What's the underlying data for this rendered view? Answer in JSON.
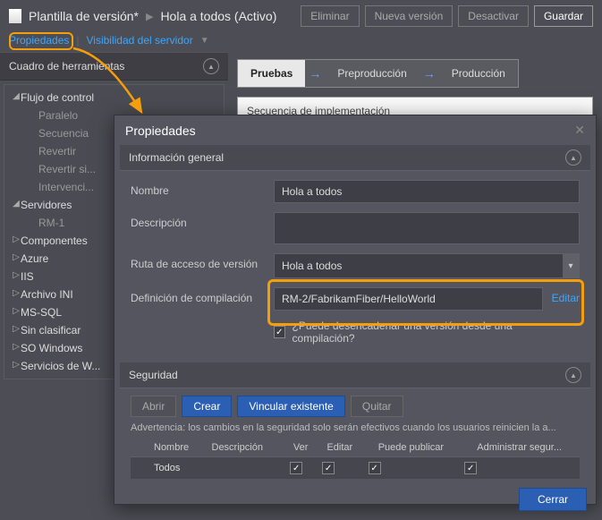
{
  "header": {
    "template_title": "Plantilla de versión*",
    "active_title": "Hola a todos (Activo)",
    "buttons": {
      "delete": "Eliminar",
      "new_version": "Nueva versión",
      "deactivate": "Desactivar",
      "save": "Guardar"
    }
  },
  "tabs": {
    "properties": "Propiedades",
    "server_visibility": "Visibilidad del servidor"
  },
  "toolbox": {
    "title": "Cuadro de herramientas",
    "flow_control": "Flujo de control",
    "flow_items": [
      "Paralelo",
      "Secuencia",
      "Revertir",
      "Revertir si...",
      "Intervenci..."
    ],
    "servers": "Servidores",
    "server_items": [
      "RM-1"
    ],
    "other_groups": [
      "Componentes",
      "Azure",
      "IIS",
      "Archivo INI",
      "MS-SQL",
      "Sin clasificar",
      "SO Windows",
      "Servicios de W..."
    ]
  },
  "stages": {
    "pruebas": "Pruebas",
    "preprod": "Preproducción",
    "prod": "Producción"
  },
  "sequence_label": "Secuencia de implementación",
  "panel": {
    "title": "Propiedades",
    "seccion_general": "Información general",
    "nombre_label": "Nombre",
    "nombre_value": "Hola a todos",
    "descripcion_label": "Descripción",
    "descripcion_value": "",
    "ruta_label": "Ruta de acceso de versión",
    "ruta_value": "Hola a todos",
    "def_label": "Definición de compilación",
    "def_value": "RM-2/FabrikamFiber/HelloWorld",
    "editar": "Editar",
    "trigger_label": "¿Puede desencadenar una versión desde una compilación?",
    "seguridad": "Seguridad",
    "btn_abrir": "Abrir",
    "btn_crear": "Crear",
    "btn_vincular": "Vincular existente",
    "btn_quitar": "Quitar",
    "warning": "Advertencia: los cambios en la seguridad solo serán efectivos cuando los usuarios reinicien la a...",
    "cols": {
      "nombre": "Nombre",
      "descripcion": "Descripción",
      "ver": "Ver",
      "editar": "Editar",
      "publicar": "Puede publicar",
      "admin": "Administrar segur..."
    },
    "row_todos": "Todos",
    "cerrar": "Cerrar"
  }
}
